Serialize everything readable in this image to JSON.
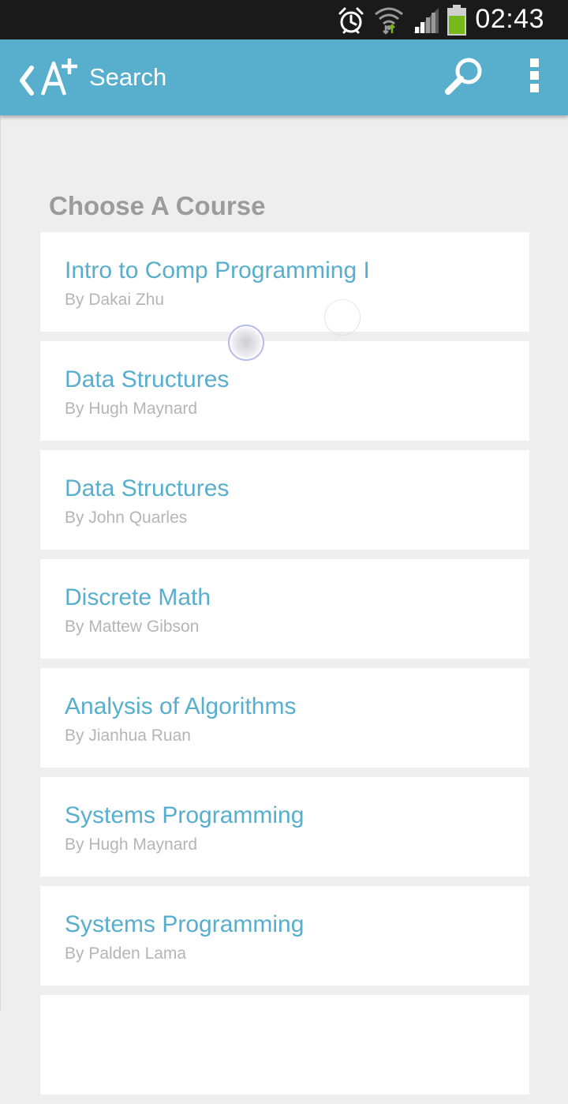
{
  "status_bar": {
    "time": "02:43",
    "icons": [
      "alarm-icon",
      "wifi-icon",
      "signal-icon",
      "battery-icon"
    ],
    "colors": {
      "background": "#1a1a1a",
      "battery_fill": "#77b81a"
    }
  },
  "action_bar": {
    "title": "Search",
    "logo": "A+",
    "icons": [
      "back-chevron-icon",
      "search-icon",
      "overflow-menu-icon"
    ],
    "colors": {
      "background": "#58aecd",
      "foreground": "#ffffff"
    }
  },
  "main": {
    "section_title": "Choose A Course",
    "courses": [
      {
        "title": "Intro to Comp Programming I",
        "author": "By Dakai Zhu"
      },
      {
        "title": "Data Structures",
        "author": "By Hugh Maynard"
      },
      {
        "title": "Data Structures",
        "author": "By John Quarles"
      },
      {
        "title": "Discrete Math",
        "author": "By Mattew Gibson"
      },
      {
        "title": "Analysis of Algorithms",
        "author": "By Jianhua Ruan"
      },
      {
        "title": "Systems Programming",
        "author": "By Hugh Maynard"
      },
      {
        "title": "Systems Programming",
        "author": "By Palden Lama"
      },
      {
        "title": "",
        "author": ""
      }
    ],
    "colors": {
      "course_title": "#58aecd",
      "course_author": "#b5b5b5",
      "section_title": "#9b9b9b"
    }
  }
}
